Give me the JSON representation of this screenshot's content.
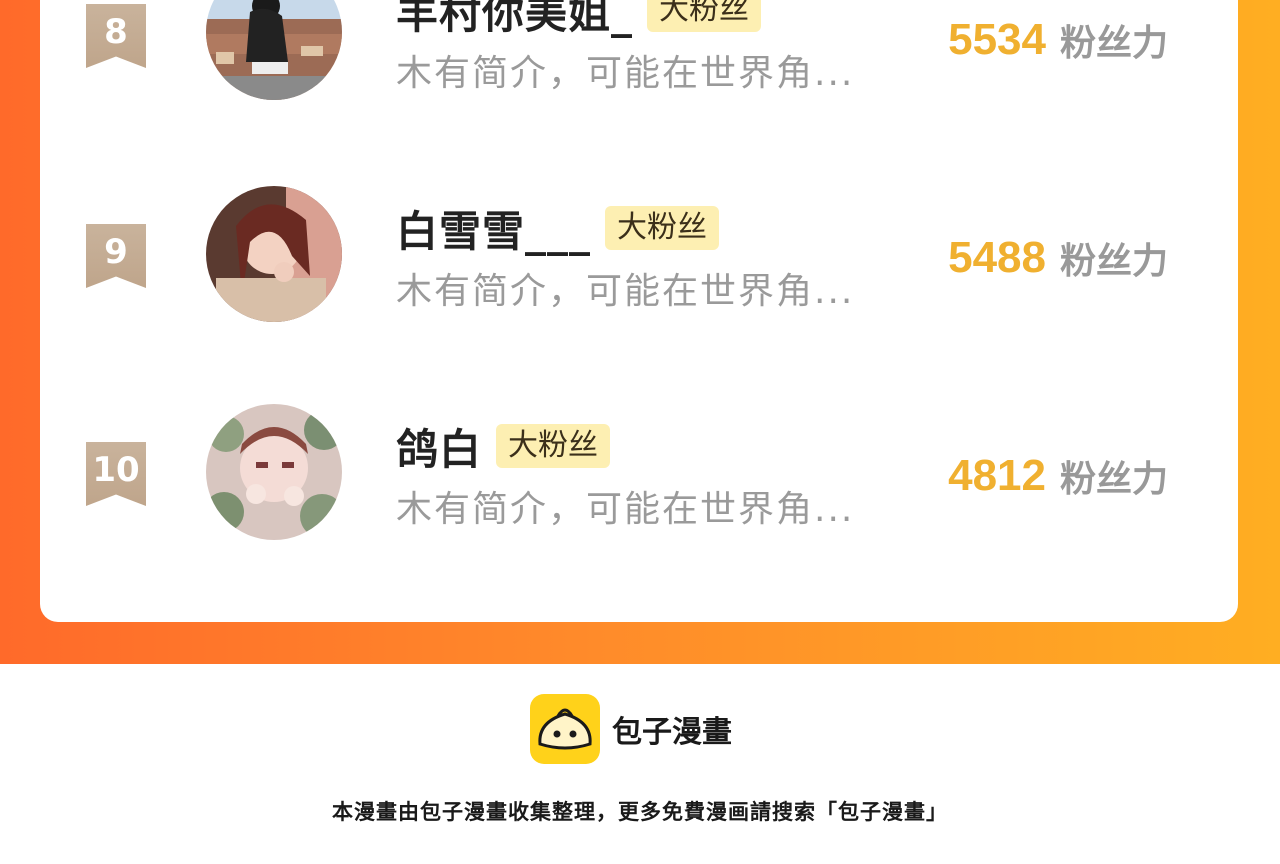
{
  "ranking": {
    "rows": [
      {
        "rank": "8",
        "name": "羊村你美姐_",
        "badge": "大粉丝",
        "intro": "木有简介，可能在世界角...",
        "fans_value": "5534",
        "fans_label": "粉丝力"
      },
      {
        "rank": "9",
        "name": "白雪雪___",
        "badge": "大粉丝",
        "intro": "木有简介，可能在世界角...",
        "fans_value": "5488",
        "fans_label": "粉丝力"
      },
      {
        "rank": "10",
        "name": "鸽白",
        "badge": "大粉丝",
        "intro": "木有简介，可能在世界角...",
        "fans_value": "4812",
        "fans_label": "粉丝力"
      }
    ]
  },
  "footer": {
    "brand": "包子漫畫",
    "note": "本漫畫由包子漫畫收集整理，更多免費漫画請搜索「包子漫畫」"
  },
  "colors": {
    "banner_start": "#ff6a2a",
    "banner_end": "#ffae22",
    "fans_value": "#f0b030",
    "badge_bg": "#fdefb2",
    "rank_badge": "#c9b39c",
    "logo_bg": "#ffd21a"
  }
}
